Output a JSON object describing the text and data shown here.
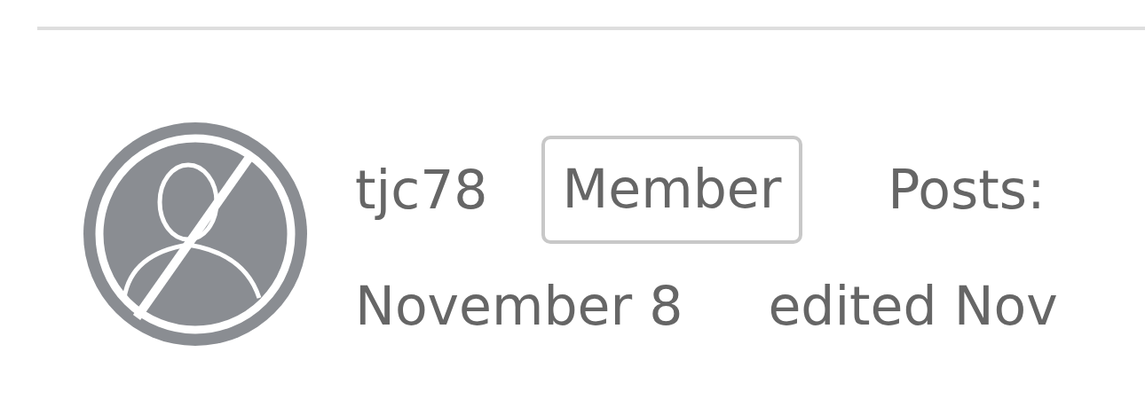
{
  "author": {
    "name": "tjc78",
    "role_badge": "Member",
    "posts_label": "Posts:",
    "date": "November 8",
    "edited": "edited Nov"
  }
}
